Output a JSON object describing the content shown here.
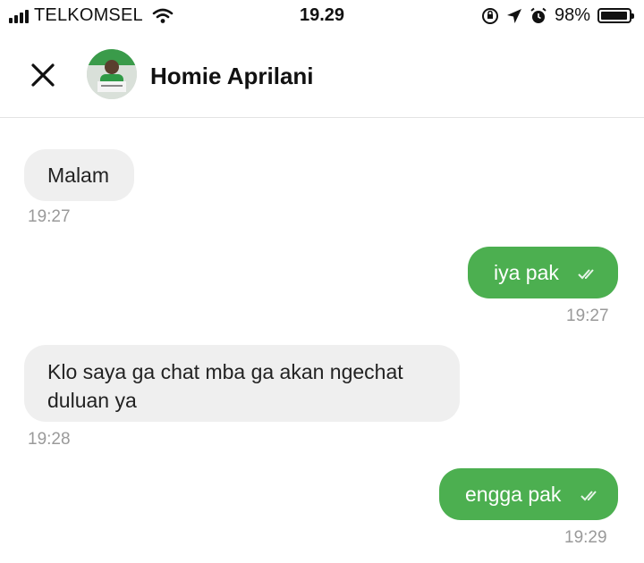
{
  "status_bar": {
    "carrier": "TELKOMSEL",
    "time": "19.29",
    "battery_percent": "98%",
    "battery_level": 0.98,
    "icons": [
      "signal-icon",
      "wifi-icon",
      "orientation-lock-icon",
      "location-icon",
      "alarm-icon",
      "battery-icon"
    ]
  },
  "header": {
    "contact_name": "Homie Aprilani",
    "close_icon": "close-icon"
  },
  "messages": [
    {
      "direction": "incoming",
      "text": "Malam",
      "time": "19:27"
    },
    {
      "direction": "outgoing",
      "text": "iya pak",
      "time": "19:27",
      "read": true
    },
    {
      "direction": "incoming",
      "text_line1": "Klo saya ga chat mba ga akan ngechat",
      "text_line2": "duluan ya",
      "time": "19:28"
    },
    {
      "direction": "outgoing",
      "text": "engga pak",
      "time": "19:29",
      "read": true
    }
  ],
  "colors": {
    "outgoing_bubble": "#4caf50",
    "incoming_bubble": "#efefef",
    "timestamp": "#9a9a9a"
  }
}
